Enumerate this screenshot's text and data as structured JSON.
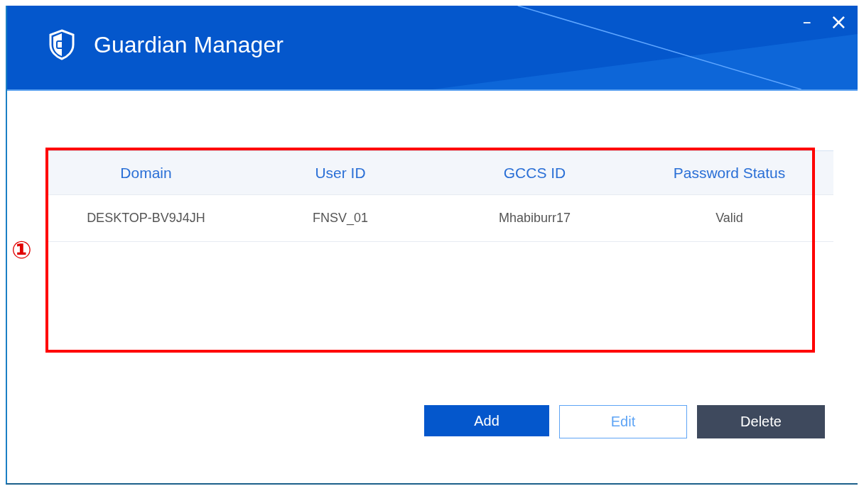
{
  "window": {
    "title": "Guardian Manager",
    "controls": [
      {
        "kind": "minimize",
        "label": "–"
      },
      {
        "kind": "close",
        "label": "×"
      }
    ]
  },
  "table": {
    "columns": [
      "Domain",
      "User ID",
      "GCCS ID",
      "Password Status"
    ],
    "rows": [
      [
        "DESKTOP-BV9J4JH",
        "FNSV_01",
        "Mhabiburr17",
        "Valid"
      ]
    ]
  },
  "annotation": {
    "label": "①"
  },
  "buttons": [
    {
      "label": "Add",
      "kind": "primary"
    },
    {
      "label": "Edit",
      "kind": "outline"
    },
    {
      "label": "Delete",
      "kind": "dark"
    }
  ]
}
